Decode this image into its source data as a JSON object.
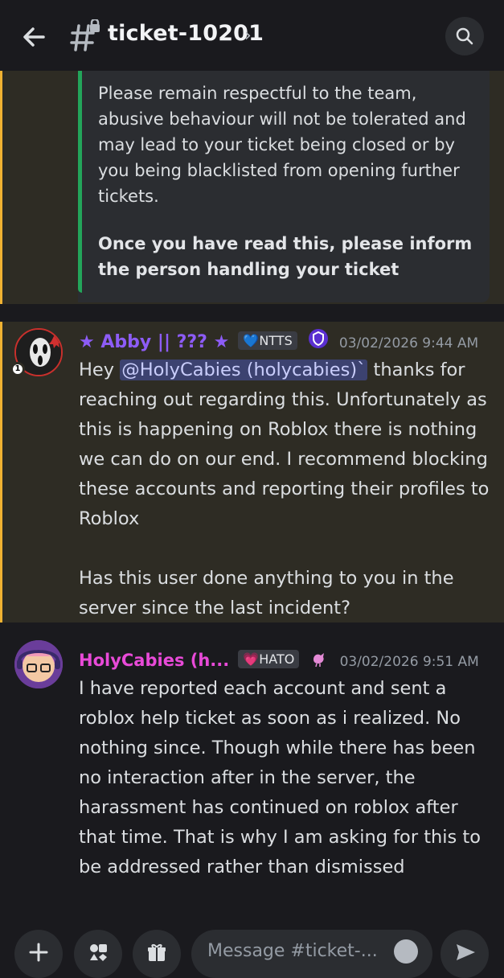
{
  "header": {
    "channel_name": "ticket-10201",
    "back_icon": "arrow-left-icon",
    "channel_icon": "locked-hash-icon",
    "search_icon": "search-icon"
  },
  "embed": {
    "text": "Please remain respectful to the team,\nabusive behaviour will not be tolerated and\nmay lead to your ticket being closed or by\nyou being blacklisted from opening further\ntickets.",
    "bold_text": "Once you have read this, please inform the person handling your ticket",
    "accent_color": "#23a55a"
  },
  "messages": [
    {
      "author": "★ Abby || ??? ★",
      "tag": "💙NTTS",
      "timestamp": "03/02/2026 9:44 AM",
      "name_color": "#8d5cf6",
      "greeting": "Hey ",
      "mention": "@HolyCabies (holycabies)`",
      "text": " thanks for reaching out regarding this. Unfortunately as this is happening on Roblox there is nothing we can do on our end. I recommend blocking these accounts and reporting their profiles to Roblox\n\nHas this user done anything to you in the server since the last incident?"
    },
    {
      "author": "HolyCabies (h...",
      "tag": "💗HATO",
      "timestamp": "03/02/2026 9:51 AM",
      "name_color": "#e84ad8",
      "text": "I have reported each account and sent a roblox help ticket as soon as i realized. No nothing since. Though while there has been no interaction after in the server, the harassment has continued on roblox after that time. That is why I am asking for this to be addressed rather than dismissed"
    }
  ],
  "composer": {
    "placeholder": "Message #ticket-..."
  }
}
